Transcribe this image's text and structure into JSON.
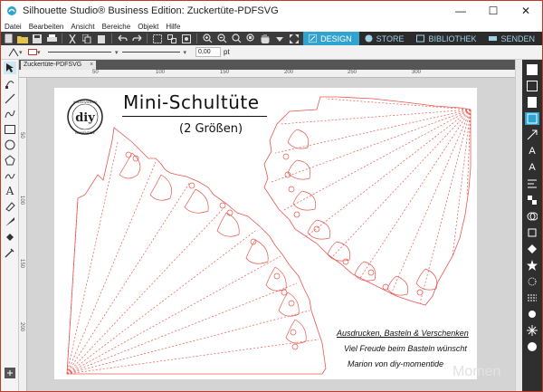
{
  "window": {
    "title": "Silhouette Studio® Business Edition: Zuckertüte-PDFSVG",
    "controls": {
      "minimize": "—",
      "maximize": "☐",
      "close": "✕"
    }
  },
  "menu": [
    "Datei",
    "Bearbeiten",
    "Ansicht",
    "Bereiche",
    "Objekt",
    "Hilfe"
  ],
  "tabs": [
    {
      "label": "DESIGN",
      "active": true
    },
    {
      "label": "STORE",
      "active": false
    },
    {
      "label": "BIBLIOTHEK",
      "active": false
    },
    {
      "label": "SENDEN",
      "active": false
    }
  ],
  "options": {
    "line_width_value": "0,00",
    "line_width_unit": "pt"
  },
  "document": {
    "tab_label": "Zuckertüte-PDFSVG",
    "close": "×"
  },
  "ruler": {
    "top": [
      "50",
      "100",
      "150",
      "200",
      "250",
      "300"
    ],
    "left": [
      "50",
      "100",
      "150",
      "200"
    ]
  },
  "page": {
    "title": "Mini-Schultüte",
    "subtitle": "(2 Größen)",
    "notes": [
      "Ausdrucken, Basteln & Verschenken",
      "Viel Freude beim Basteln wünscht",
      "Marion von diy-momentide"
    ],
    "logo_text": "diy MOMENTIDE",
    "watermark": "Momen"
  },
  "colors": {
    "accent": "#31a3cf",
    "cut_line": "#e8574f",
    "toolbar": "#3c3c3c",
    "frame": "#c0392b"
  }
}
